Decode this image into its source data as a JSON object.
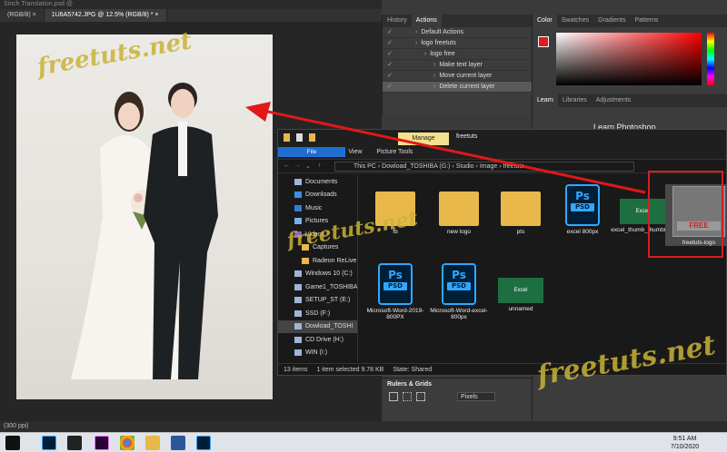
{
  "ps": {
    "top_title": "Sinch Translation.psd @",
    "tabs": [
      "(RGB/8) ×",
      "1U6A5742.JPG @ 12.5% (RGB/8) * ×"
    ],
    "status": "(300 ppi)",
    "history_tab": "History",
    "actions_tab": "Actions",
    "actions": [
      {
        "label": "Default Actions",
        "indent": 1
      },
      {
        "label": "logo freetuts",
        "indent": 1
      },
      {
        "label": "logo free",
        "indent": 2
      },
      {
        "label": "Make text layer",
        "indent": 3
      },
      {
        "label": "Move current layer",
        "indent": 3
      },
      {
        "label": "Delete current layer",
        "indent": 3
      }
    ],
    "color_tabs": [
      "Color",
      "Swatches",
      "Gradients",
      "Patterns"
    ],
    "learn_tabs": [
      "Learn",
      "Libraries",
      "Adjustments"
    ],
    "learn_title": "Learn Photoshop",
    "rulers_title": "Rulers & Grids",
    "pixels_select": "Pixels"
  },
  "explorer": {
    "manage": "Manage",
    "title": "freetuts",
    "ribbon": [
      "File",
      "Home",
      "Share",
      "View",
      "Picture Tools"
    ],
    "path": [
      "This PC",
      "Dowload_TOSHIBA (G:)",
      "Studio",
      "Image",
      "freetuts"
    ],
    "nav": [
      "Documents",
      "Downloads",
      "Music",
      "Pictures",
      "Videos",
      "Captures",
      "Radeon ReLive",
      "Windows 10 (C:)",
      "Game1_TOSHIBA",
      "SETUP_ST (E:)",
      "SSD (F:)",
      "Dowload_TOSHI",
      "CD Drive (H:)",
      "WIN (I:)"
    ],
    "files": [
      {
        "name": "fb",
        "type": "folder"
      },
      {
        "name": "new logo",
        "type": "folder"
      },
      {
        "name": "pts",
        "type": "folder"
      },
      {
        "name": "excel 800px",
        "type": "psd"
      },
      {
        "name": "excel_thumb_thumb800",
        "type": "excel"
      },
      {
        "name": "freetuts-logo",
        "type": "image"
      },
      {
        "name": "Microsoft-Word-2019-800PX",
        "type": "psd"
      },
      {
        "name": "Microsoft-Word-excel-800px",
        "type": "psd"
      },
      {
        "name": "unnamed",
        "type": "excel"
      }
    ],
    "psd_label": "Ps",
    "psd_badge": "PSD",
    "excel_label": "Excel",
    "status": {
      "items": "13 items",
      "selected": "1 item selected  9.78 KB",
      "state": "State: Shared"
    }
  },
  "taskbar": {
    "time": "9:51 AM",
    "date": "7/10/2020"
  },
  "watermark": "freetuts.net"
}
